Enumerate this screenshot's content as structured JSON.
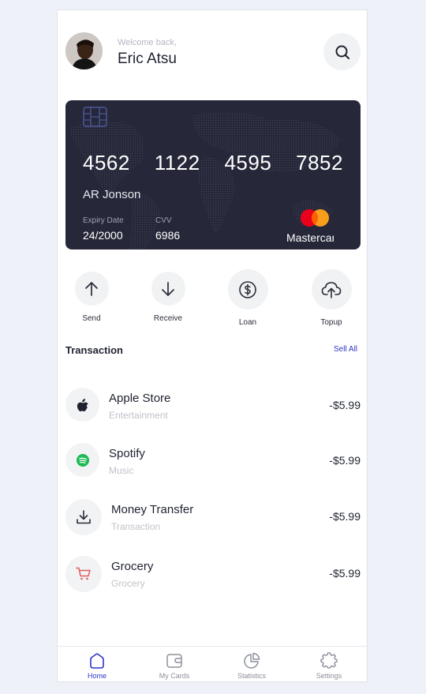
{
  "header": {
    "welcome": "Welcome back,",
    "username": "Eric Atsu"
  },
  "card": {
    "number_groups": [
      "4562",
      "1122",
      "4595",
      "7852"
    ],
    "holder": "AR Jonson",
    "expiry_label": "Expiry Date",
    "expiry": "24/2000",
    "cvv_label": "CVV",
    "cvv": "6986",
    "brand": "Mastercard",
    "colors": {
      "background": "#262839",
      "mc_red": "#eb001b",
      "mc_orange": "#f79e1b"
    }
  },
  "actions": [
    {
      "label": "Send",
      "icon": "arrow-up-icon"
    },
    {
      "label": "Receive",
      "icon": "arrow-down-icon"
    },
    {
      "label": "Loan",
      "icon": "dollar-circle-icon"
    },
    {
      "label": "Topup",
      "icon": "cloud-upload-icon"
    }
  ],
  "transactions": {
    "title": "Transaction",
    "see_all": "Sell All",
    "items": [
      {
        "name": "Apple Store",
        "category": "Entertainment",
        "amount": "-$5.99",
        "icon": "apple-icon"
      },
      {
        "name": "Spotify",
        "category": "Music",
        "amount": "-$5.99",
        "icon": "spotify-icon"
      },
      {
        "name": "Money Transfer",
        "category": "Transaction",
        "amount": "-$5.99",
        "icon": "download-icon"
      },
      {
        "name": "Grocery",
        "category": "Grocery",
        "amount": "-$5.99",
        "icon": "cart-icon"
      }
    ]
  },
  "nav": {
    "items": [
      {
        "label": "Home",
        "icon": "home-icon",
        "active": true
      },
      {
        "label": "My Cards",
        "icon": "wallet-icon",
        "active": false
      },
      {
        "label": "Statistics",
        "icon": "pie-chart-icon",
        "active": false
      },
      {
        "label": "Settings",
        "icon": "gear-icon",
        "active": false
      }
    ],
    "active_color": "#2d36c8"
  }
}
